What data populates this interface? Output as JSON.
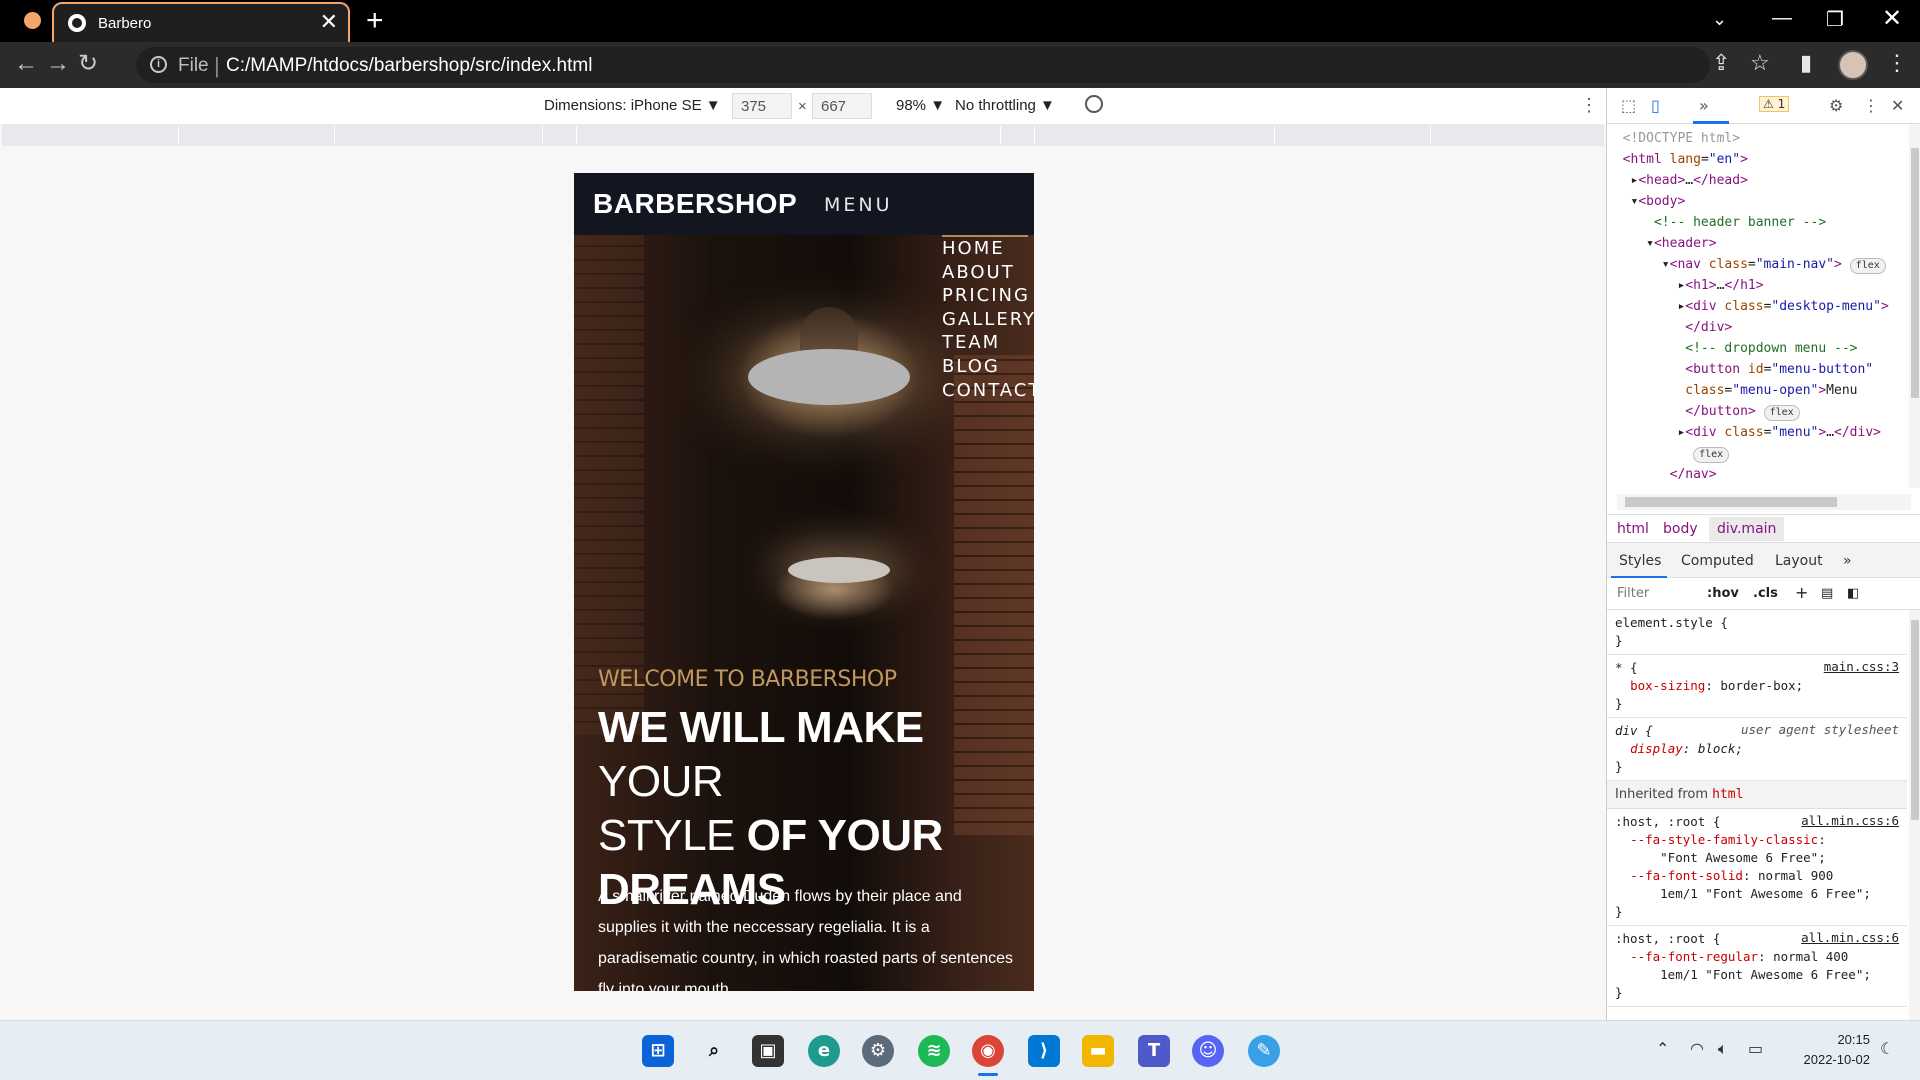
{
  "browser": {
    "tab_title": "Barbero",
    "tab_close": "✕",
    "new_tab": "+",
    "file_label": "File",
    "url": "C:/MAMP/htdocs/barbershop/src/index.html",
    "accent_color": "#f3a56a"
  },
  "device_toolbar": {
    "dimensions_label": "Dimensions: iPhone SE ▼",
    "width": "375",
    "times": "×",
    "height": "667",
    "zoom": "98% ▼",
    "throttling": "No throttling ▼"
  },
  "site": {
    "logo": "BARBERSHOP",
    "menu_button": "MENU",
    "menu_items": [
      "HOME",
      "ABOUT",
      "PRICING",
      "GALLERY",
      "TEAM",
      "BLOG",
      "CONTACT"
    ],
    "welcome": "WELCOME TO BARBERSHOP",
    "headline_1": "WE WILL MAKE",
    "headline_2": "YOUR",
    "headline_3": "STYLE",
    "headline_4": "OF YOUR",
    "headline_5": "DREAMS",
    "paragraph": "A small river named Duden flows by their place and supplies it with the neccessary regelialia. It is a paradisematic country, in which roasted parts of sentences fly into your mouth.",
    "accent_color": "#c0985d"
  },
  "devtools": {
    "warning_count": "1",
    "dom_lines": [
      {
        "indent": 0,
        "html": "<span class='gray'>&lt;!DOCTYPE html&gt;</span>"
      },
      {
        "indent": 0,
        "html": "<span class='tag'>&lt;html</span> <span class='attr'>lang</span>=<span class='val'>\"en\"</span><span class='tag'>&gt;</span>"
      }
    ],
    "breadcrumbs": [
      "html",
      "body",
      "div.main"
    ],
    "sub_tabs": [
      "Styles",
      "Computed",
      "Layout",
      "»"
    ],
    "filter_placeholder": "Filter",
    "hov": ":hov",
    "cls": ".cls",
    "element_style": "element.style {",
    "rule1_selector": "* {",
    "rule1_source": "main.css:3",
    "rule1_prop": "box-sizing",
    "rule1_value": "border-box;",
    "rule2_selector": "div {",
    "rule2_source": "user agent stylesheet",
    "rule2_prop": "display",
    "rule2_value": "block;",
    "inherited_label": "Inherited from",
    "inherited_tag": "html",
    "rule3_selector": ":host, :root {",
    "rule3_source": "all.min.css:6",
    "rule3_line1_prop": "--fa-style-family-classic",
    "rule3_line1_val": "\"Font Awesome 6 Free\";",
    "rule3_line2_prop": "--fa-font-solid",
    "rule3_line2_val": "normal 900",
    "rule3_line3_val": "1em/1 \"Font Awesome 6 Free\";",
    "rule4_selector": ":host, :root {",
    "rule4_source": "all.min.css:6",
    "rule4_line1_prop": "--fa-font-regular",
    "rule4_line1_val": "normal 400",
    "rule4_line2_val": "1em/1 \"Font Awesome 6 Free\";",
    "close_brace": "}"
  },
  "taskbar": {
    "time": "20:15",
    "date": "2022-10-02"
  }
}
